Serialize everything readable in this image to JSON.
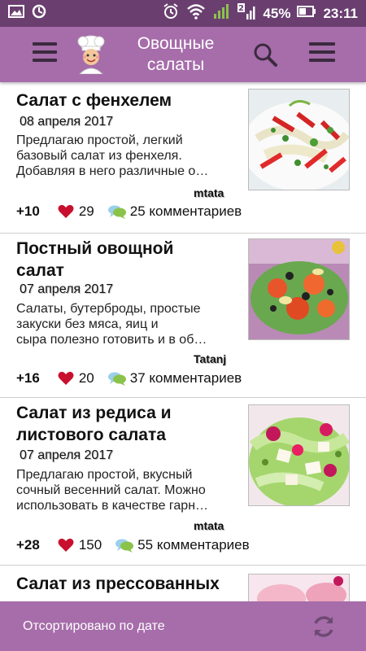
{
  "status": {
    "battery": "45%",
    "time": "23:11",
    "sim": "2"
  },
  "appbar": {
    "title_line1": "Овощные",
    "title_line2": "салаты"
  },
  "items": [
    {
      "title": "Салат с фенхелем",
      "date": "08 апреля 2017",
      "desc_lines": [
        "Предлагаю простой, легкий",
        "базовый салат из фенхеля.",
        "Добавляя в него различные о…"
      ],
      "author": "mtata",
      "votes": "+10",
      "likes": "29",
      "comments": "25 комментариев"
    },
    {
      "title_lines": [
        "Постный овощной",
        "салат"
      ],
      "date": "07 апреля 2017",
      "desc_lines": [
        "Салаты, бутерброды, простые",
        "закуски без мяса, яиц и",
        "сыра полезно готовить и в об…"
      ],
      "author": "Tatanj",
      "votes": "+16",
      "likes": "20",
      "comments": "37 комментариев"
    },
    {
      "title_lines": [
        "Салат из редиса и",
        "листового салата"
      ],
      "date": "07 апреля 2017",
      "desc_lines": [
        "Предлагаю простой, вкусный",
        "сочный весенний салат. Можно",
        "использовать в качестве гарн…"
      ],
      "author": "mtata",
      "votes": "+28",
      "likes": "150",
      "comments": "55 комментариев"
    },
    {
      "title": "Салат из прессованных"
    }
  ],
  "bottom": {
    "sort_label": "Отсортировано по дате"
  },
  "colors": {
    "statusbar": "#6a3f70",
    "appbar": "#a66daa",
    "heart": "#c8102e",
    "divider": "#d0d0d0"
  },
  "icons": [
    "gallery-icon",
    "sync-icon",
    "alarm-icon",
    "wifi-icon",
    "data-icon",
    "signal-icon",
    "battery-icon",
    "hamburger-icon",
    "chef-logo-icon",
    "search-icon",
    "menu-icon",
    "heart-icon",
    "comments-icon",
    "refresh-icon"
  ]
}
